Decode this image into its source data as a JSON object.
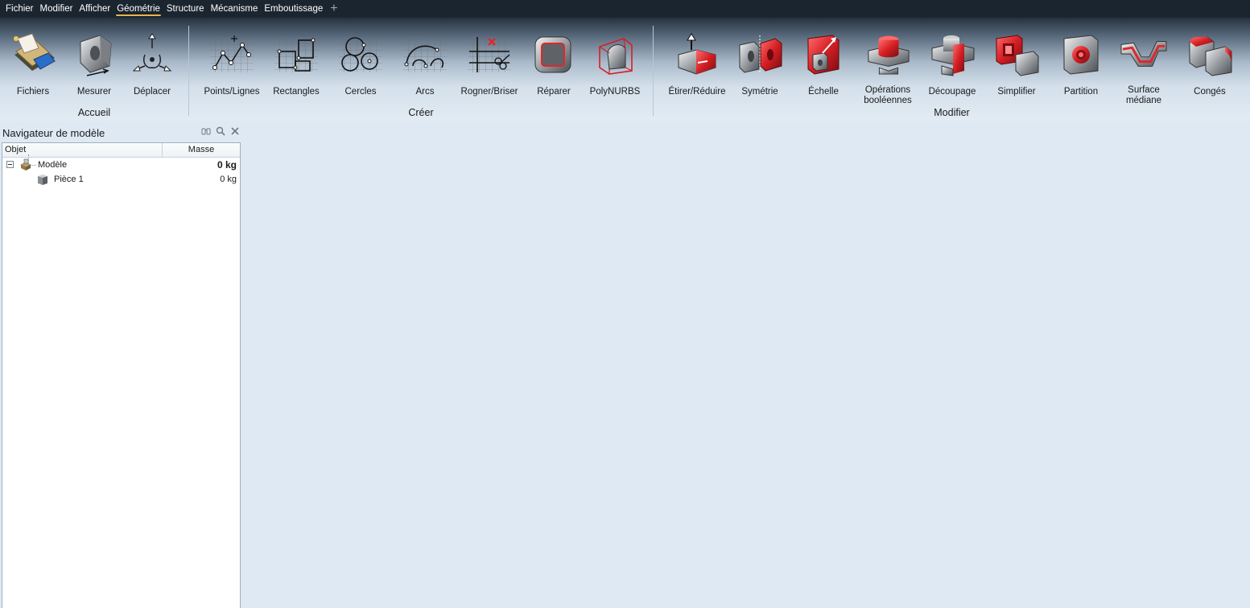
{
  "menubar": {
    "items": [
      {
        "label": "Fichier",
        "active": false
      },
      {
        "label": "Modifier",
        "active": false
      },
      {
        "label": "Afficher",
        "active": false
      },
      {
        "label": "Géométrie",
        "active": true
      },
      {
        "label": "Structure",
        "active": false
      },
      {
        "label": "Mécanisme",
        "active": false
      },
      {
        "label": "Emboutissage",
        "active": false
      }
    ],
    "add_icon": "plus-icon"
  },
  "ribbon": {
    "groups": {
      "accueil": {
        "label": "Accueil",
        "tools": [
          {
            "label": "Fichiers",
            "icon": "files-icon"
          },
          {
            "label": "Mesurer",
            "icon": "measure-icon"
          },
          {
            "label": "Déplacer",
            "icon": "move-icon"
          }
        ]
      },
      "creer": {
        "label": "Créer",
        "tools": [
          {
            "label": "Points/Lignes",
            "icon": "points-lines-icon"
          },
          {
            "label": "Rectangles",
            "icon": "rectangles-icon"
          },
          {
            "label": "Cercles",
            "icon": "circles-icon"
          },
          {
            "label": "Arcs",
            "icon": "arcs-icon"
          },
          {
            "label": "Rogner/Briser",
            "icon": "trim-break-icon"
          },
          {
            "label": "Réparer",
            "icon": "repair-icon"
          },
          {
            "label": "PolyNURBS",
            "icon": "polynurbs-icon"
          }
        ]
      },
      "modifier": {
        "label": "Modifier",
        "tools": [
          {
            "label": "Étirer/Réduire",
            "icon": "push-pull-icon"
          },
          {
            "label": "Symétrie",
            "icon": "mirror-icon"
          },
          {
            "label": "Échelle",
            "icon": "scale-icon"
          },
          {
            "label": "Opérations\nbooléennes",
            "icon": "boolean-icon"
          },
          {
            "label": "Découpage",
            "icon": "split-icon"
          },
          {
            "label": "Simplifier",
            "icon": "simplify-icon"
          },
          {
            "label": "Partition",
            "icon": "partition-icon"
          },
          {
            "label": "Surface médiane",
            "icon": "midsurface-icon"
          },
          {
            "label": "Congés",
            "icon": "fillets-icon"
          }
        ]
      }
    }
  },
  "navigator": {
    "title": "Navigateur de modèle",
    "actions": [
      "binoculars-icon",
      "search-icon",
      "close-icon"
    ],
    "columns": {
      "object": "Objet",
      "mass": "Masse"
    },
    "rows": [
      {
        "name": "Modèle",
        "mass": "0 kg",
        "icon": "model-icon",
        "expanded": true
      },
      {
        "name": "Pièce 1",
        "mass": "0 kg",
        "icon": "part-icon"
      }
    ]
  },
  "colors": {
    "menubar_bg": "#1b2530",
    "active_tab_underline": "#e8b44a",
    "accent_red": "#d9262b",
    "workspace_bg": "#dfe9f3"
  }
}
